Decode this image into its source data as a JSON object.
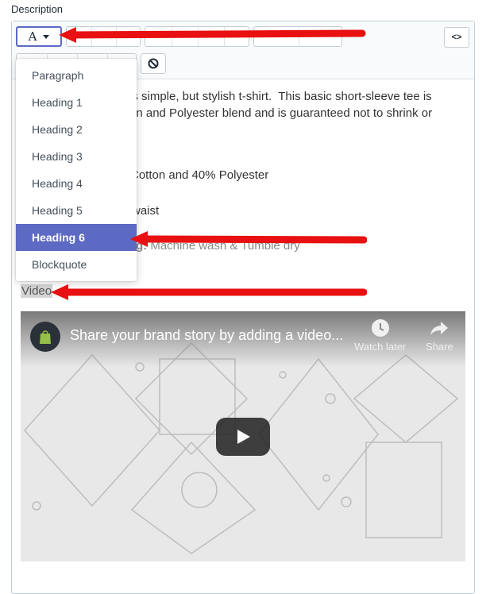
{
  "field": {
    "label": "Description"
  },
  "toolbar": {
    "font_glyph": "A",
    "code_label": "<>"
  },
  "format_menu": {
    "items": [
      {
        "label": "Paragraph"
      },
      {
        "label": "Heading 1"
      },
      {
        "label": "Heading 2"
      },
      {
        "label": "Heading 3"
      },
      {
        "label": "Heading 4"
      },
      {
        "label": "Heading 5"
      },
      {
        "label": "Heading 6",
        "selected": true
      },
      {
        "label": "Blockquote"
      }
    ]
  },
  "content": {
    "line1": "is simple, but stylish t-shirt.  This basic short-sleeve tee is",
    "line2": "on and Polyester blend and is guaranteed not to shrink or",
    "line3": "Cotton and 40% Polyester",
    "line4": "waist",
    "line5_bold": "g:",
    "line5_text": " Machine wash & Tumble dry",
    "video_word": "Video"
  },
  "video": {
    "title": "Share your brand story by adding a video...",
    "watch_later": "Watch later",
    "share": "Share"
  },
  "colors": {
    "accent": "#5c6ac4",
    "arrow": "#e81010"
  }
}
